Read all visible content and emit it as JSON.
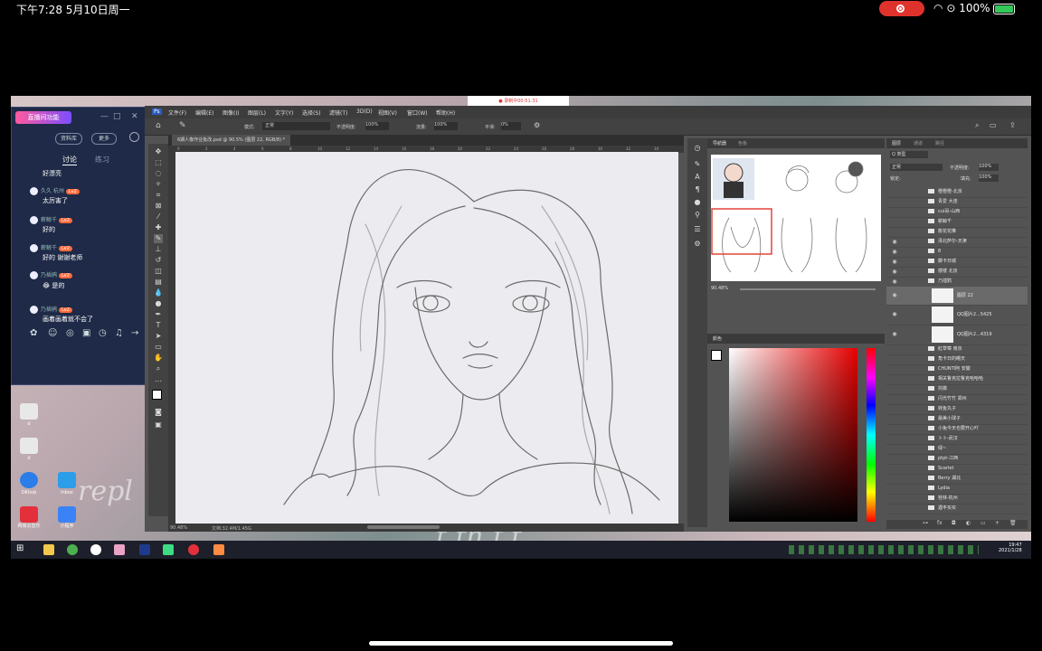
{
  "status_bar": {
    "time_date": "下午7:28   5月10日周一",
    "battery": "100%"
  },
  "chat": {
    "banner": "直播间功能",
    "win_controls": [
      "—",
      "□",
      "✕"
    ],
    "buttons": [
      "资料库",
      "更多"
    ],
    "tabs": [
      "讨论",
      "练习"
    ],
    "messages": [
      {
        "name": "",
        "text": "好漂亮"
      },
      {
        "name": "久久 杭州",
        "badge": "Lv2",
        "text": "太厉害了"
      },
      {
        "name": "薪鲸千",
        "badge": "Lv2",
        "text": "好的"
      },
      {
        "name": "薪鲸千",
        "badge": "Lv2",
        "text": "好的 谢谢老师"
      },
      {
        "name": "乃插鸦",
        "badge": "Lv2",
        "text": "😂 是的"
      },
      {
        "name": "乃插鸦",
        "badge": "Lv2",
        "text": "画着画着就不会了"
      }
    ]
  },
  "desktop": {
    "script_text_1": "repl",
    "script_text_2": "t  th    f  t",
    "icons": [
      {
        "label": "d"
      },
      {
        "label": "d"
      },
      {
        "label": "OKhub"
      },
      {
        "label": "Inbox"
      },
      {
        "label": "网易云音乐"
      },
      {
        "label": "小程序"
      }
    ]
  },
  "photoshop": {
    "menu": [
      "文件(F)",
      "编辑(E)",
      "图像(I)",
      "图层(L)",
      "文字(Y)",
      "选择(S)",
      "滤镜(T)",
      "3D(D)",
      "视图(V)",
      "窗口(W)",
      "帮助(H)"
    ],
    "recording": "● 录制中00:51:31",
    "options": {
      "mode_label": "模式:",
      "mode": "正常",
      "opacity_label": "不透明度:",
      "opacity": "100%",
      "flow_label": "流量:",
      "flow": "100%",
      "smooth_label": "平滑:",
      "smooth": "0%"
    },
    "doc_tab": "6期人像作业批改.psd @ 90.5% (图层 22, RGB/8) *",
    "ruler_ticks": [
      "0",
      "2",
      "4",
      "6",
      "8",
      "10",
      "12",
      "14",
      "16",
      "18",
      "20",
      "22",
      "24",
      "26",
      "28",
      "30",
      "32",
      "34"
    ],
    "zoom": "90.48%",
    "doc_size": "文档:32.4M/1.45G",
    "navigator": {
      "tabs": [
        "导航器",
        "色板"
      ],
      "zoom": "90.48%"
    },
    "color_panel": {
      "title": "颜色"
    },
    "layers_panel": {
      "tabs": [
        "图层",
        "通道",
        "路径"
      ],
      "kind": "Q 类型",
      "blend": "正常",
      "opacity_label": "不透明度:",
      "opacity": "100%",
      "lock_label": "锁定:",
      "fill_label": "填充:",
      "fill": "100%",
      "layers": [
        "橙橙橙-北京",
        "青爱 大连",
        "cui哥-山西",
        "薪鲸千",
        "桃花花椎",
        "泽北萨尔-天津",
        "8",
        "脚卡日城",
        "楼楼 北京",
        "乃插鸦",
        "图层 22",
        "QQ图片2...5425",
        "QQ图片2...4319",
        "紅草莓 南京",
        "角卡日的曙天",
        "CHUNTI阿 安徽",
        "相关鲁克拉鲁克哈哈哈",
        "抖擞",
        "闪光竹竹 郑州",
        "转鱼丸子",
        "最美小球子",
        "小兔今天也要开心吖",
        "卜卜-武汉",
        "绿~",
        "ptpt-江西",
        "Scarlet",
        "Berry 湖北",
        "Lydia",
        "桂林-杭州",
        "遇丰买买"
      ]
    }
  },
  "taskbar": {
    "time": "19:47",
    "date": "2021/1/28"
  },
  "colors": {
    "ps_bg": "#535353",
    "chat_bg": "#1e2a47",
    "rec_red": "#e0322d"
  }
}
